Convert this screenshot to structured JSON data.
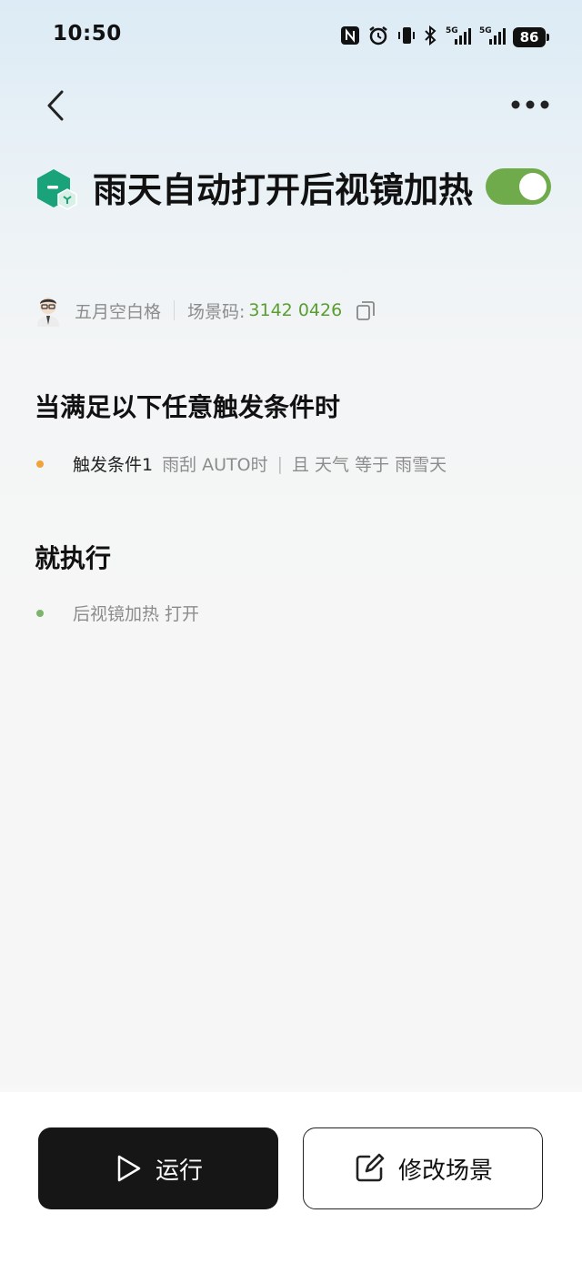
{
  "status_bar": {
    "time": "10:50",
    "network_1": "5G",
    "network_2": "5G",
    "battery": "86",
    "icons": [
      "nfc-icon",
      "alarm-icon",
      "vibrate-icon",
      "bluetooth-icon",
      "signal-5g-icon",
      "signal-5g-icon",
      "battery-icon"
    ]
  },
  "header": {
    "back_icon": "chevron-left-icon",
    "more_icon": "more-horizontal-icon"
  },
  "scene": {
    "title": "雨天自动打开后视镜加热",
    "enabled": true,
    "icon": "scene-hexagon-icon",
    "author": "五月空白格",
    "code_label": "场景码: ",
    "code_value": "3142 0426",
    "copy_icon": "copy-icon"
  },
  "triggers": {
    "title": "当满足以下任意触发条件时",
    "items": [
      {
        "label": "触发条件1",
        "condition_1": "雨刮 AUTO时",
        "separator": "|",
        "condition_2": "且 天气 等于 雨雪天",
        "dot_color": "#f0a33a"
      }
    ]
  },
  "actions": {
    "title": "就执行",
    "items": [
      {
        "text": "后视镜加热 打开",
        "dot_color": "#7cb56a"
      }
    ]
  },
  "footer": {
    "run_label": "运行",
    "edit_label": "修改场景"
  },
  "colors": {
    "accent_green": "#6fab4a",
    "code_green": "#5a9e2f",
    "run_button_bg": "#161616"
  }
}
